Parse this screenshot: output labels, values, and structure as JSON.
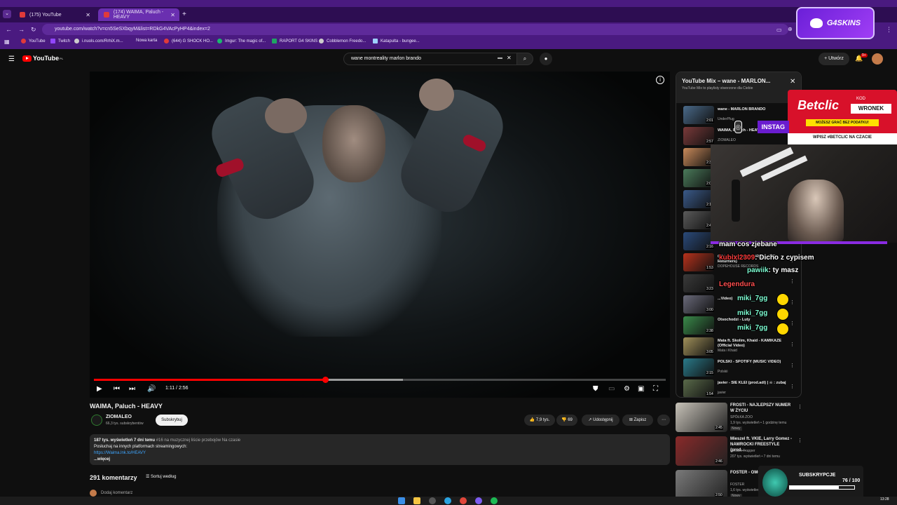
{
  "browser": {
    "tabs": [
      {
        "label": "(175) YouTube"
      },
      {
        "label": "(174) WAIMA, Paluch - HEAVY"
      }
    ],
    "url": "youtube.com/watch?v=cn5SeSXbqyM&list=RDkG4VAcPyHP4&index=2",
    "bookmarks": [
      "YouTube",
      "Twitch",
      "i.nuols.com/RrhiX.m...",
      "Nowa karta",
      "(644) G SHOCK HO...",
      "Imgur: The magic of...",
      "RAPORT G4 SKINS",
      "Cobblemon Freedo...",
      "Katapulta - bungee..."
    ],
    "sponsor_badge": "G4SKINS"
  },
  "youtube": {
    "logo": "YouTube",
    "logo_region": "PL",
    "search_query": "wane montreality marlon brando",
    "create_label": "Utwórz",
    "notif_count": "9+"
  },
  "player": {
    "current_time": "1:11 / 2:56",
    "progress_fraction": 0.404,
    "buffered_fraction": 0.54
  },
  "video": {
    "title": "WAIMA, Paluch - HEAVY",
    "channel": "ZIOMALEO",
    "subscribers": "66,3 tys. subskrybentów",
    "subscribe_label": "Subskrybuj",
    "likes": "7,9 tys.",
    "dislikes": "69",
    "share_label": "Udostępnij",
    "save_label": "Zapisz",
    "desc_stats": "187 tys. wyświetleń  7 dni temu",
    "desc_rank": "#16 na muzycznej liście przebojów Na czasie",
    "desc_line2": "Posłuchaj na innych platformach streamingowych:",
    "desc_link": "https://Waima.lnk.to/HEAVY",
    "desc_more": "...więcej",
    "comments_count": "291 komentarzy",
    "sort_label": "Sortuj według",
    "add_comment": "Dodaj komentarz"
  },
  "mix": {
    "title": "YouTube Mix – wane - MARLON...",
    "subtitle": "YouTube Mix to playlisty stworzone dla Ciebie",
    "items": [
      {
        "title": "wane - MARLON BRANDO",
        "author": "UnderPlug",
        "dur": "2:01"
      },
      {
        "title": "WAIMA, Paluch - HEAVY",
        "author": "ZIOMALEO",
        "dur": "2:57"
      },
      {
        "title": "",
        "author": "",
        "dur": "2:35"
      },
      {
        "title": "",
        "author": "",
        "dur": "2:03"
      },
      {
        "title": "",
        "author": "",
        "dur": "2:18"
      },
      {
        "title": "",
        "author": "",
        "dur": "2:48"
      },
      {
        "title": "",
        "author": "",
        "dur": "2:16"
      },
      {
        "title": "Gibbs - Imny ft. SVMIR (prod. The Returners)",
        "author": "DOPEHOUSE RECORDS",
        "dur": "1:53"
      },
      {
        "title": "",
        "author": "",
        "dur": "3:23"
      },
      {
        "title": "...Video)",
        "author": "",
        "dur": "3:00"
      },
      {
        "title": "Otsochodzi - Luty",
        "author": "",
        "dur": "2:38"
      },
      {
        "title": "Mata ft. Skolim, Khaid - KAMIKAZE (Official Video)",
        "author": "Mata i Khaid",
        "dur": "3:05"
      },
      {
        "title": "POLSKI - SPOTIFY (MUSIC VIDEO)",
        "author": "Polskii",
        "dur": "2:15"
      },
      {
        "title": "javier - SIE KLEI (prod.adi) | ☠ : zubaj",
        "author": "javier",
        "dur": "1:54"
      }
    ]
  },
  "recommended": [
    {
      "title": "FROSTI - NAJLEPSZY NUMER W ŻYCIU",
      "author": "SPÓŁKA ZOO",
      "meta": "1,9 tys. wyświetleń • 1 godzinę temu",
      "badge": "Nowy",
      "dur": "2:45"
    },
    {
      "title": "Mieszel ft. VKIE, Larry Gomez - NAWROCKI FREESTYLE (prod....",
      "author": "Mieszel Trapper",
      "meta": "207 tys. wyświetleń • 7 dni temu",
      "badge": "",
      "dur": "2:46"
    },
    {
      "title": "FOSTER - OMOR...",
      "author": "FOSTER",
      "meta": "1,6 tys. wyświetleń • 1 go...",
      "badge": "Nowy",
      "dur": "2:50"
    }
  ],
  "overlay": {
    "instagram": "INSTAG",
    "betclic": {
      "brand": "Betclic",
      "kod": "KOD",
      "code": "WRONEK",
      "promo": "MOŻESZ GRAĆ BEZ PODATKU!",
      "cta": "WPISZ #BETCLIC NA CZACIE"
    },
    "chat": [
      {
        "user": "",
        "msg": "mam cos zjebane"
      },
      {
        "user": "kubixl2309",
        "msg": ": Dicho z cypisem"
      },
      {
        "user": "pawiik",
        "msg": ": ty masz"
      },
      {
        "user": "Legendura",
        "msg": ""
      },
      {
        "user": "miki_7gg",
        "msg": ""
      },
      {
        "user": "miki_7gg",
        "msg": ""
      },
      {
        "user": "miki_7gg",
        "msg": ""
      }
    ],
    "subs_label": "SUBSKRYPCJE",
    "subs_count": "76 / 100",
    "subs_fraction": 0.76
  },
  "taskbar": {
    "clock": "13:28"
  }
}
